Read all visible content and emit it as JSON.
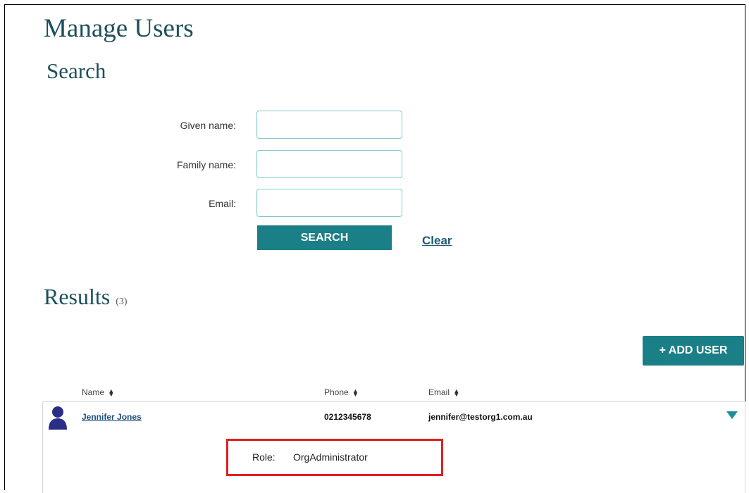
{
  "header": {
    "title": "Manage Users",
    "subtitle": "Search"
  },
  "search": {
    "given_name_label": "Given name:",
    "family_name_label": "Family name:",
    "email_label": "Email:",
    "given_name_value": "",
    "family_name_value": "",
    "email_value": "",
    "search_button": "SEARCH",
    "clear_link": "Clear"
  },
  "results": {
    "title": "Results",
    "count": "(3)",
    "add_user_button": "+ ADD USER",
    "columns": {
      "name": "Name",
      "phone": "Phone",
      "email": "Email"
    },
    "rows": [
      {
        "name": "Jennifer Jones",
        "phone": "0212345678",
        "email": "jennifer@testorg1.com.au",
        "role_label": "Role:",
        "role_value": "OrgAdministrator"
      }
    ]
  },
  "colors": {
    "accent": "#1a7f86",
    "heading": "#1d4f5c",
    "highlight": "#e02020"
  }
}
